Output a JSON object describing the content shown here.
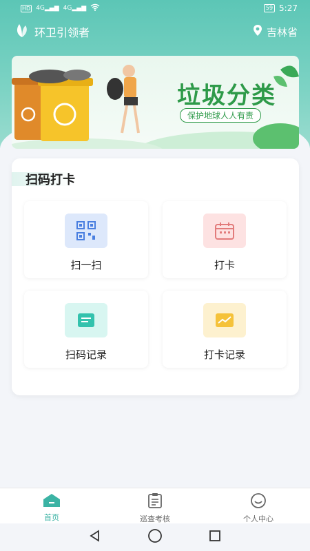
{
  "status_bar": {
    "network_left": "HD",
    "signal1": "4G",
    "signal2": "4G",
    "battery": "59",
    "time": "5:27"
  },
  "header": {
    "app_name": "环卫引领者",
    "location": "吉林省"
  },
  "banner": {
    "title": "垃圾分类",
    "subtitle": "保护地球人人有责"
  },
  "section": {
    "title": "扫码打卡",
    "tiles": [
      {
        "label": "扫一扫",
        "icon": "qr-code-icon",
        "color": "#dde8fb"
      },
      {
        "label": "打卡",
        "icon": "calendar-icon",
        "color": "#fde2e2"
      },
      {
        "label": "扫码记录",
        "icon": "scan-record-icon",
        "color": "#d8f6f1"
      },
      {
        "label": "打卡记录",
        "icon": "checkin-record-icon",
        "color": "#fdf1cf"
      }
    ]
  },
  "tabs": [
    {
      "label": "首页",
      "icon": "home-icon",
      "active": true
    },
    {
      "label": "巡查考核",
      "icon": "clipboard-icon",
      "active": false
    },
    {
      "label": "个人中心",
      "icon": "user-icon",
      "active": false
    }
  ],
  "colors": {
    "accent": "#3bb3a4",
    "header": "#5cc6b6",
    "banner_green": "#2e9a49"
  }
}
